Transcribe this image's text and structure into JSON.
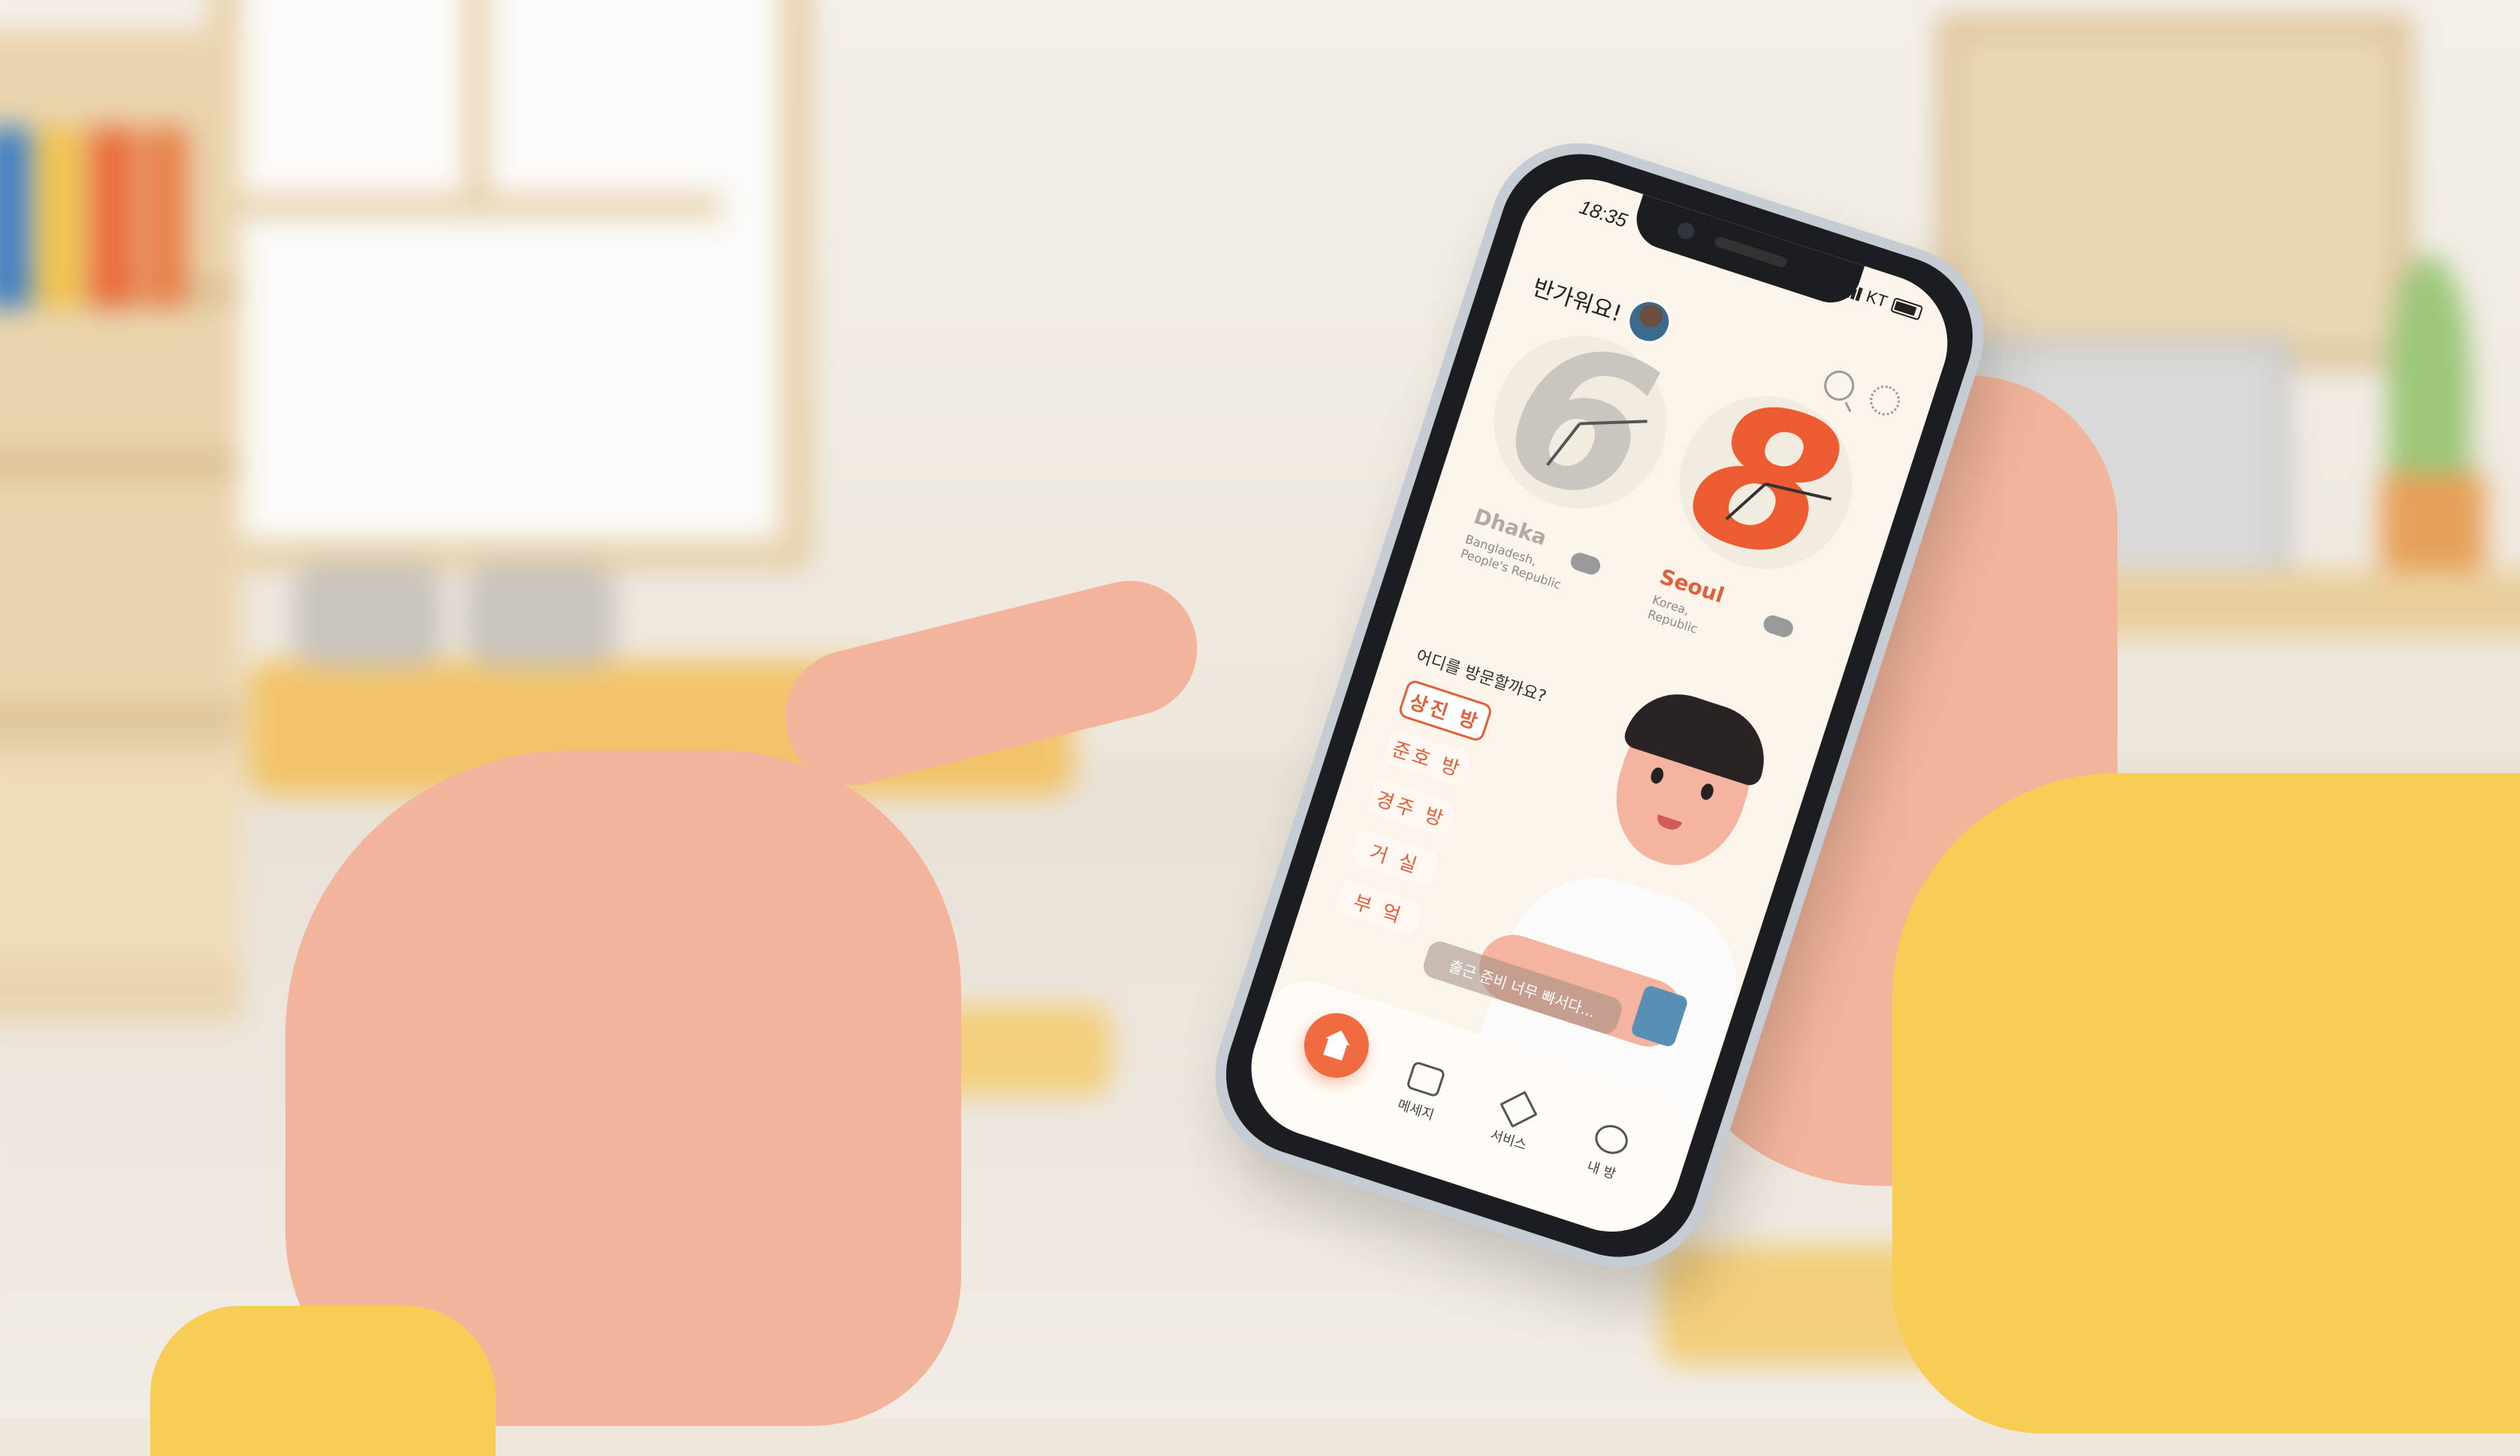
{
  "status": {
    "time": "18:35",
    "carrier": "KT"
  },
  "header": {
    "greeting": "반가워요!"
  },
  "clocks": [
    {
      "digit": "6",
      "city": "Dhaka",
      "country": "Bangladesh, People's Republic"
    },
    {
      "digit": "8",
      "city": "Seoul",
      "country": "Korea, Republic"
    }
  ],
  "visit": {
    "prompt": "어디를 방문할까요?",
    "rooms": [
      "상진 방",
      "준호 방",
      "경주 방",
      "거 실",
      "부 엌"
    ]
  },
  "speech": "출근 준비 너무 빠서다...",
  "tabs": {
    "messages": "메세지",
    "services": "서비스",
    "my_room": "내 방"
  },
  "colors": {
    "accent": "#e0603c",
    "background": "#fbf4ea"
  }
}
